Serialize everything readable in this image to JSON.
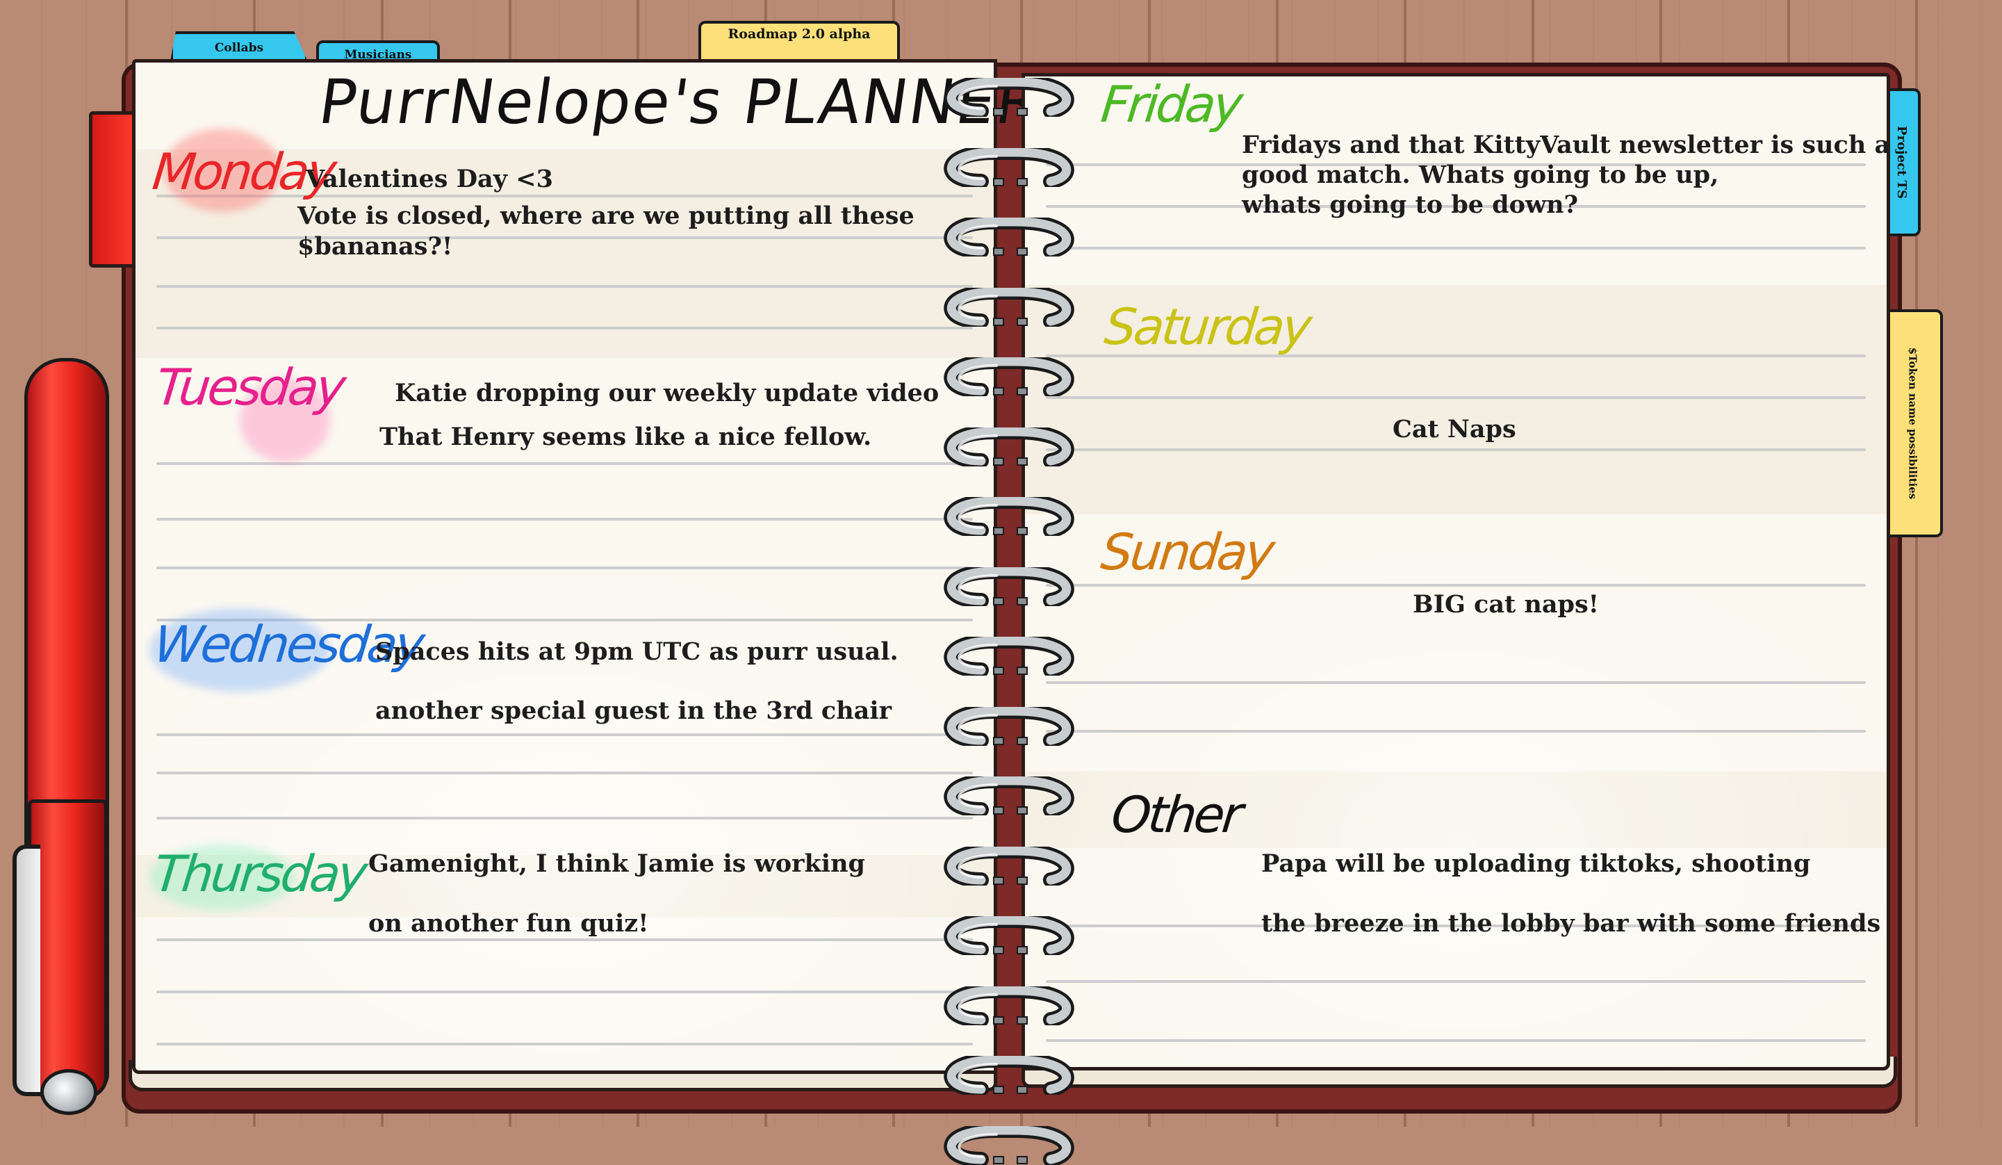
{
  "planner": {
    "title": "PurrNelope's PLANNER"
  },
  "tabs": {
    "top": [
      {
        "label": "Collabs",
        "color": "#35c7ee"
      },
      {
        "label": "Musicians",
        "color": "#35c7ee"
      },
      {
        "label": "Roadmap 2.0 alpha",
        "color": "#fde07a"
      }
    ],
    "side": [
      {
        "label": "Project TS",
        "color": "#35c7ee"
      },
      {
        "label": "$Token name possibilities",
        "color": "#fde07a"
      }
    ]
  },
  "days": {
    "monday": {
      "label": "Monday",
      "color": "#e8262a",
      "lines": [
        "Valentines Day <3",
        "Vote is closed, where are we putting all these",
        "$bananas?!"
      ]
    },
    "tuesday": {
      "label": "Tuesday",
      "color": "#e6208d",
      "lines": [
        "Katie dropping our weekly update video",
        "That Henry seems like a nice fellow."
      ]
    },
    "wednesday": {
      "label": "Wednesday",
      "color": "#1e6fd9",
      "lines": [
        "Spaces hits at 9pm UTC as purr usual.",
        "another special guest in the 3rd chair"
      ]
    },
    "thursday": {
      "label": "Thursday",
      "color": "#1fae6c",
      "lines": [
        "Gamenight, I think Jamie is working",
        "on another fun quiz!"
      ]
    },
    "friday": {
      "label": "Friday",
      "color": "#4cb925",
      "lines": [
        "Fridays and that KittyVault newsletter is such a",
        "good match. Whats going to be up,",
        "whats going to be down?"
      ]
    },
    "saturday": {
      "label": "Saturday",
      "color": "#cbc218",
      "lines": [
        "Cat Naps"
      ]
    },
    "sunday": {
      "label": "Sunday",
      "color": "#d27a12",
      "lines": [
        "BIG cat naps!"
      ]
    },
    "other": {
      "label": "Other",
      "color": "#111111",
      "lines": [
        "Papa will be uploading tiktoks, shooting",
        "the breeze in the lobby bar with some friends"
      ]
    }
  }
}
